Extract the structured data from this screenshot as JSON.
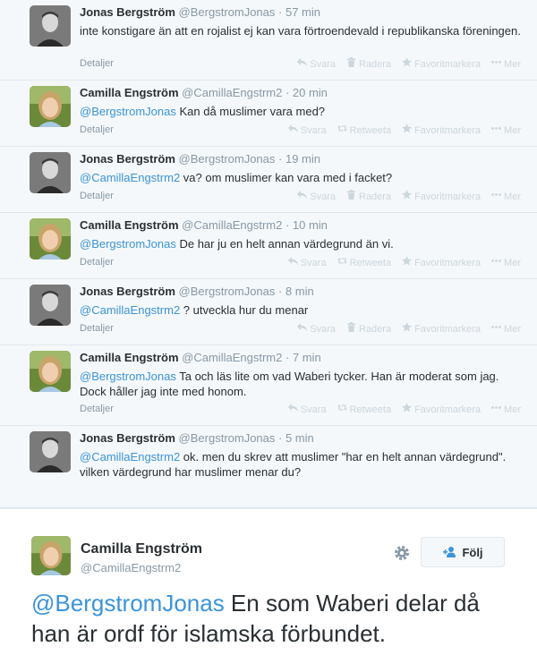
{
  "labels": {
    "details": "Detaljer",
    "reply": "Svara",
    "delete": "Radera",
    "retweet": "Retweeta",
    "favorite": "Favoritmarkera",
    "more": "Mer"
  },
  "tweets": [
    {
      "name": "Jonas Bergström",
      "handle": "@BergstromJonas",
      "sep": " · ",
      "time": "57 min",
      "mention": "",
      "text": "inte konstigare än att en rojalist ej kan vara förtroendevald i republikanska föreningen.",
      "second_action": "Radera",
      "avatar": "man"
    },
    {
      "name": "Camilla Engström",
      "handle": "@CamillaEngstrm2",
      "sep": " · ",
      "time": "20 min",
      "mention": "@BergstromJonas",
      "text": " Kan då muslimer vara med?",
      "second_action": "Retweeta",
      "avatar": "woman"
    },
    {
      "name": "Jonas Bergström",
      "handle": "@BergstromJonas",
      "sep": " · ",
      "time": "19 min",
      "mention": "@CamillaEngstrm2",
      "text": " va? om muslimer kan vara med i facket?",
      "second_action": "Radera",
      "avatar": "man"
    },
    {
      "name": "Camilla Engström",
      "handle": "@CamillaEngstrm2",
      "sep": " · ",
      "time": "10 min",
      "mention": "@BergstromJonas",
      "text": " De har ju en helt annan värdegrund än vi.",
      "second_action": "Retweeta",
      "avatar": "woman"
    },
    {
      "name": "Jonas Bergström",
      "handle": "@BergstromJonas",
      "sep": " · ",
      "time": "8 min",
      "mention": "@CamillaEngstrm2",
      "text": " ? utveckla hur du menar",
      "second_action": "Radera",
      "avatar": "man"
    },
    {
      "name": "Camilla Engström",
      "handle": "@CamillaEngstrm2",
      "sep": " · ",
      "time": "7 min",
      "mention": "@BergstromJonas",
      "text": " Ta och läs lite om vad Waberi tycker. Han är moderat som jag. Dock håller jag inte med honom.",
      "second_action": "Retweeta",
      "avatar": "woman"
    },
    {
      "name": "Jonas Bergström",
      "handle": "@BergstromJonas",
      "sep": " · ",
      "time": "5 min",
      "mention": "@CamillaEngstrm2",
      "text": " ok. men du skrev att muslimer \"har en helt annan värdegrund\". vilken värdegrund har muslimer menar du?",
      "second_action": "",
      "avatar": "man"
    }
  ],
  "main_tweet": {
    "name": "Camilla Engström",
    "handle": "@CamillaEngstrm2",
    "follow_label": "Följ",
    "mention": "@BergstromJonas",
    "text": " En som Waberi delar då han är ordf för islamska förbundet."
  },
  "icons": {
    "reply": "reply-arrow-icon",
    "delete": "trash-icon",
    "retweet": "retweet-icon",
    "favorite": "star-icon",
    "more": "more-dots-icon",
    "gear": "gear-icon",
    "follow": "add-person-icon"
  },
  "colors": {
    "link": "#3b94d9",
    "muted": "#8899a6",
    "action": "#ccd6dd",
    "thread_bg": "#f5f8fa"
  }
}
